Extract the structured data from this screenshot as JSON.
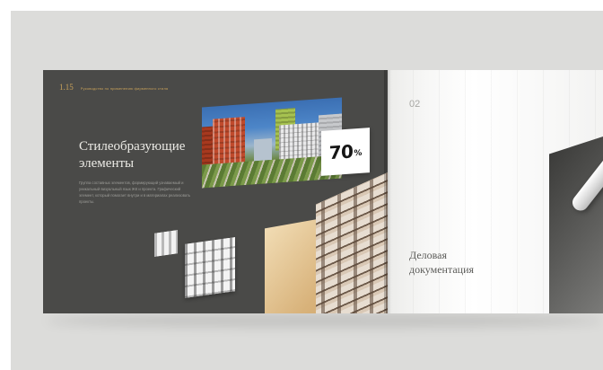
{
  "left_page": {
    "folio": {
      "number": "1.15",
      "caption": "Руководство по применению фирменного стиля"
    },
    "title": "Стилеобразующие элементы",
    "body_text": "Группа составных элементов, формирующий узнаваемый и уникальный визуальный язык ЖК и проекта. Графический элемент, который помогает внутри и в материалах реализовать проекты.",
    "stat_card": {
      "value": "70",
      "unit": "%"
    }
  },
  "right_page": {
    "page_number": "02",
    "section_title": "Деловая документация"
  },
  "colors": {
    "left_page_bg": "#4a4a48",
    "accent_gold": "#c9a25a",
    "backdrop": "#dcdcda"
  }
}
